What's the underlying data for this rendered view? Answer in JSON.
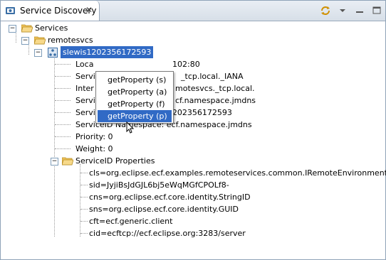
{
  "tab": {
    "title": "Service Discovery",
    "close_icon": "close-icon"
  },
  "toolbar": {
    "icons": [
      "sync-icon",
      "view-menu-icon",
      "minimize-icon",
      "maximize-icon"
    ]
  },
  "tree": {
    "root": "Services",
    "group": "remotesvcs",
    "selected_node": "slewis1202356172593",
    "details": {
      "location": "Location: ecftcp://slewis1202356172593:3282/server",
      "loc_visible": "102:80",
      "service_type_visible": "Service",
      "service_type_suffix": "_tcp.local._IANA",
      "internal_visible": "Inter",
      "internal_suffix": "motesvcs._tcp.local.",
      "service_ns_visible": "Servic",
      "service_ns_suffix": "cf.namespace.jmdns",
      "serviceid_name": "ServiceID Name: slewis1202356172593",
      "serviceid_namespace": "ServiceID Namespace: ecf.namespace.jmdns",
      "priority": "Priority: 0",
      "weight": "Weight: 0"
    },
    "properties_folder": "ServiceID Properties",
    "properties": [
      "cls=org.eclipse.ecf.examples.remoteservices.common.IRemoteEnvironmentInfo",
      "sid=JyjiBsJdGJL6bj5eWqMGfCPOLf8-",
      "cns=org.eclipse.ecf.core.identity.StringID",
      "sns=org.eclipse.ecf.core.identity.GUID",
      "cft=ecf.generic.client",
      "cid=ecftcp://ecf.eclipse.org:3283/server"
    ]
  },
  "context_menu": {
    "items": [
      "getProperty (s)",
      "getProperty (a)",
      "getProperty (f)",
      "getProperty (p)"
    ],
    "active_index": 3
  },
  "colors": {
    "selection": "#316ac5",
    "frame": "#8fa3b8"
  }
}
